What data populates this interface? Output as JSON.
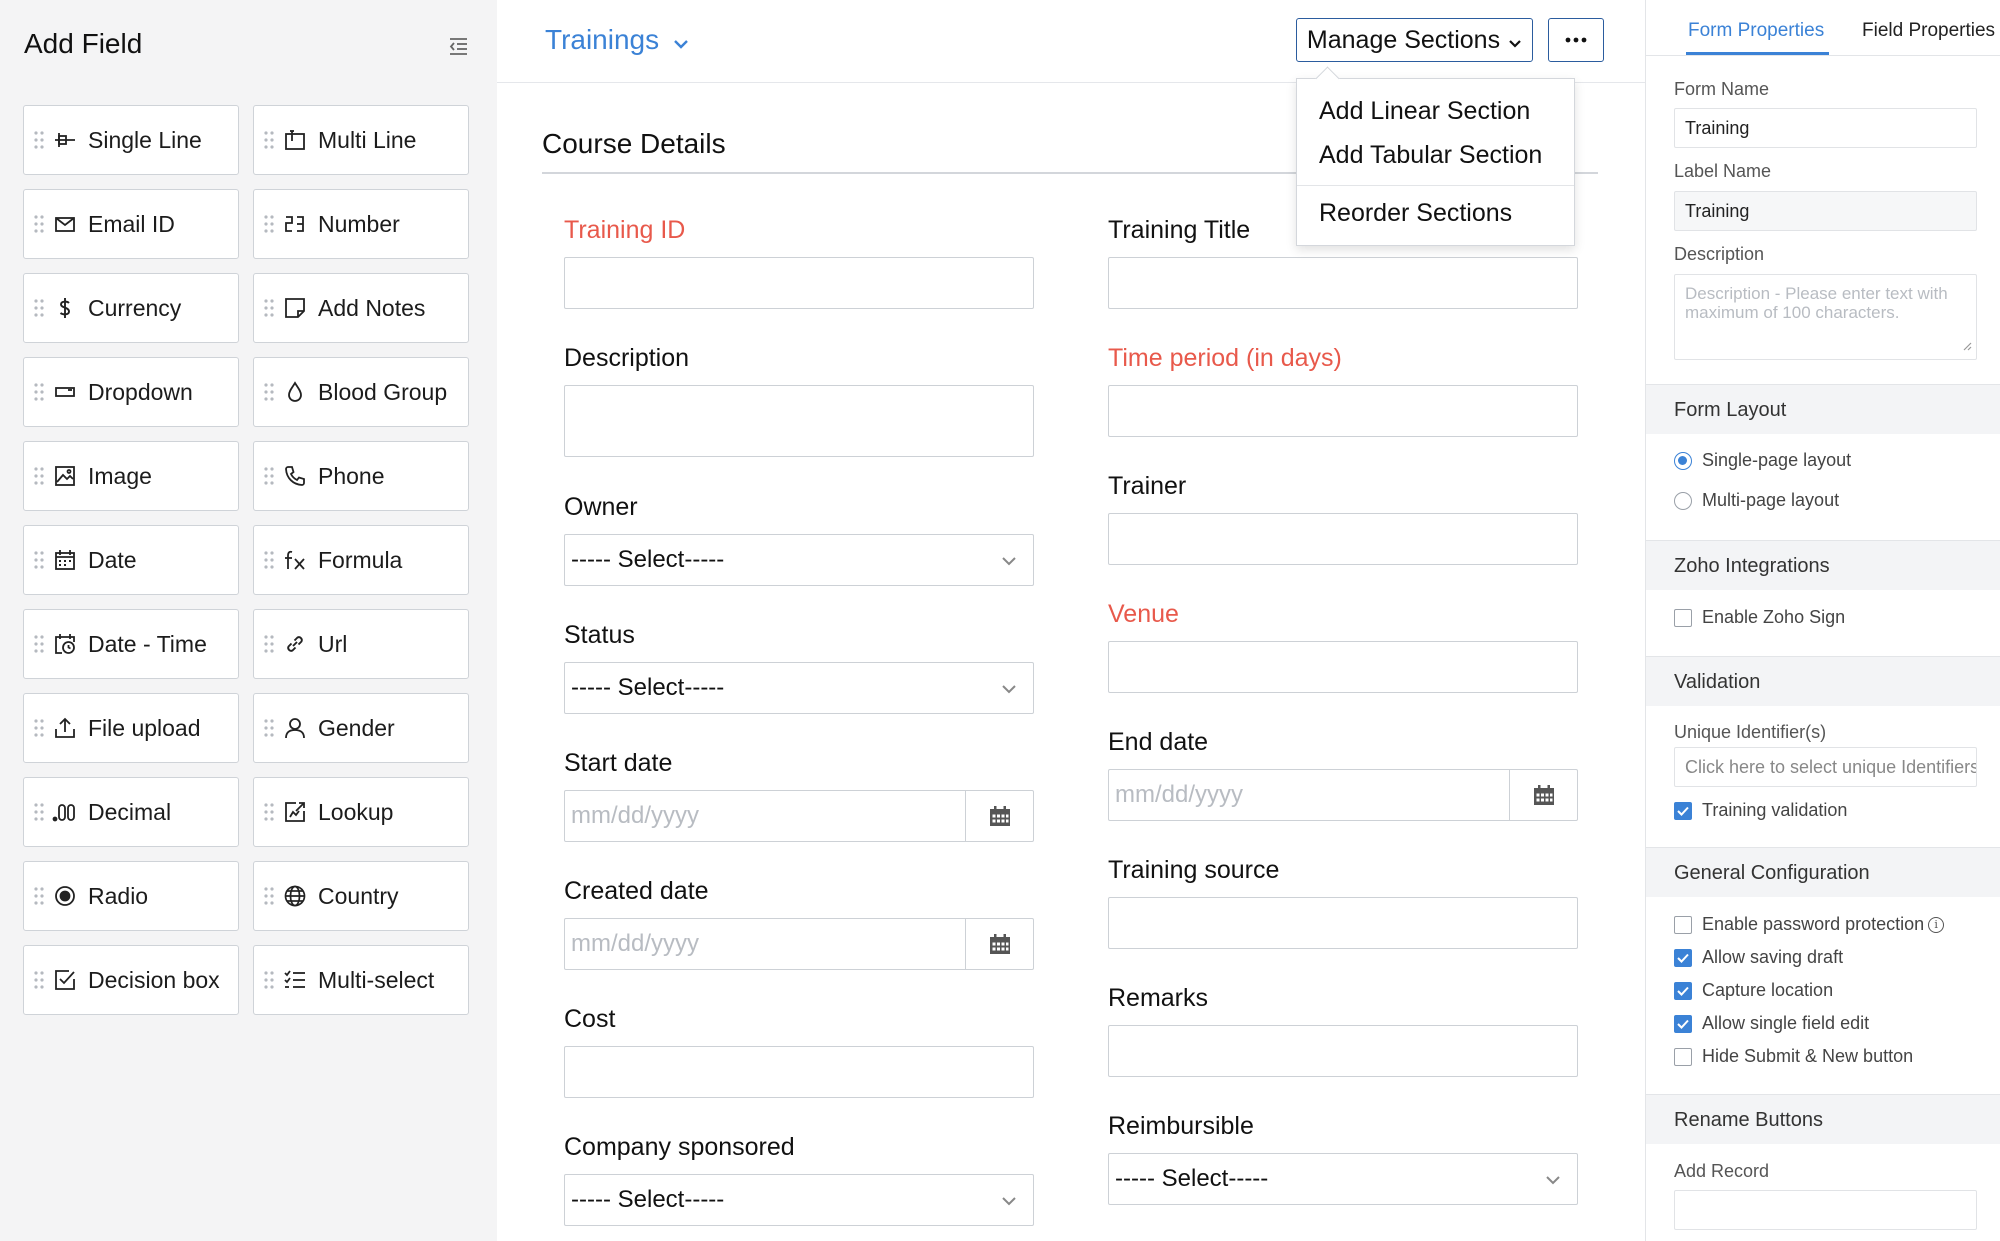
{
  "left_panel": {
    "title": "Add Field",
    "fields": [
      {
        "label": "Single Line",
        "icon": "single-line-icon"
      },
      {
        "label": "Multi Line",
        "icon": "multi-line-icon"
      },
      {
        "label": "Email ID",
        "icon": "email-icon"
      },
      {
        "label": "Number",
        "icon": "number-icon"
      },
      {
        "label": "Currency",
        "icon": "currency-icon"
      },
      {
        "label": "Add Notes",
        "icon": "notes-icon"
      },
      {
        "label": "Dropdown",
        "icon": "dropdown-icon"
      },
      {
        "label": "Blood Group",
        "icon": "drop-icon"
      },
      {
        "label": "Image",
        "icon": "image-icon"
      },
      {
        "label": "Phone",
        "icon": "phone-icon"
      },
      {
        "label": "Date",
        "icon": "calendar-icon"
      },
      {
        "label": "Formula",
        "icon": "formula-icon"
      },
      {
        "label": "Date - Time",
        "icon": "date-time-icon"
      },
      {
        "label": "Url",
        "icon": "link-icon"
      },
      {
        "label": "File upload",
        "icon": "upload-icon"
      },
      {
        "label": "Gender",
        "icon": "person-icon"
      },
      {
        "label": "Decimal",
        "icon": "decimal-icon"
      },
      {
        "label": "Lookup",
        "icon": "lookup-icon"
      },
      {
        "label": "Radio",
        "icon": "radio-icon"
      },
      {
        "label": "Country",
        "icon": "globe-icon"
      },
      {
        "label": "Decision box",
        "icon": "checkbox-icon"
      },
      {
        "label": "Multi-select",
        "icon": "checklist-icon"
      }
    ]
  },
  "header": {
    "form_title": "Trainings",
    "manage_sections": "Manage Sections",
    "more": "···"
  },
  "manage_menu": {
    "items": [
      "Add Linear Section",
      "Add Tabular Section",
      "Reorder Sections"
    ]
  },
  "section": {
    "title": "Course Details"
  },
  "form": {
    "training_id": "Training ID",
    "training_title": "Training Title",
    "description": "Description",
    "time_period": "Time period (in days)",
    "owner": "Owner",
    "trainer": "Trainer",
    "status": "Status",
    "venue": "Venue",
    "start_date": "Start date",
    "end_date": "End date",
    "created_date": "Created date",
    "training_source": "Training source",
    "cost": "Cost",
    "remarks": "Remarks",
    "company_sponsored": "Company sponsored",
    "reimbursible": "Reimbursible",
    "select_placeholder": "----- Select-----",
    "date_placeholder": "mm/dd/yyyy"
  },
  "right_panel": {
    "tabs": [
      "Form Properties",
      "Field Properties"
    ],
    "form_name_label": "Form Name",
    "form_name_value": "Training",
    "label_name_label": "Label Name",
    "label_name_value": "Training",
    "description_label": "Description",
    "description_placeholder": "Description - Please enter text with maximum of 100 characters.",
    "form_layout": {
      "title": "Form Layout",
      "options": [
        "Single-page layout",
        "Multi-page layout"
      ],
      "selected": "Single-page layout"
    },
    "zoho_integrations": {
      "title": "Zoho Integrations",
      "enable_sign": "Enable Zoho Sign"
    },
    "validation": {
      "title": "Validation",
      "unique_label": "Unique Identifier(s)",
      "unique_placeholder": "Click here to select unique Identifiers",
      "training_validation": "Training validation"
    },
    "general_config": {
      "title": "General Configuration",
      "options": [
        {
          "label": "Enable password protection",
          "checked": false
        },
        {
          "label": "Allow saving draft",
          "checked": true
        },
        {
          "label": "Capture location",
          "checked": true
        },
        {
          "label": "Allow single field edit",
          "checked": true
        },
        {
          "label": "Hide Submit & New button",
          "checked": false
        }
      ]
    },
    "rename_buttons": {
      "title": "Rename Buttons",
      "add_record_label": "Add Record"
    }
  },
  "colors": {
    "accent": "#3b82d6",
    "required": "#e8594b",
    "button_border": "#2b5c9e"
  }
}
